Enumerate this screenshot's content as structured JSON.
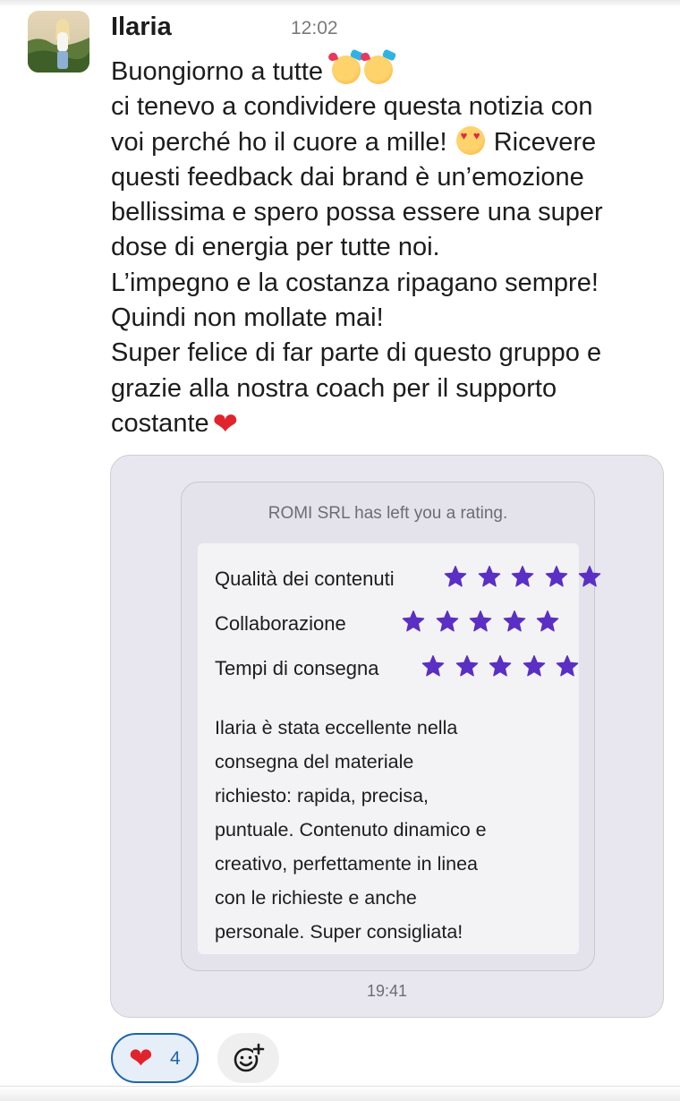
{
  "message": {
    "author": "Ilaria",
    "time": "12:02",
    "lines": [
      "Buongiorno a tutte",
      "ci tenevo a condividere questa notizia con",
      "voi perché ho il cuore a mille!",
      "Ricevere",
      "questi feedback dai brand è un’emozione",
      "bellissima e spero possa essere una super",
      "dose di energia per tutte noi.",
      "L’impegno e la costanza ripagano sempre!",
      "Quindi non mollate mai!",
      "Super felice di far parte di questo gruppo e",
      "grazie alla nostra coach per il supporto",
      "costante"
    ],
    "emoji": {
      "greeting": "smiling-face-with-hearts-icon",
      "eyes": "heart-eyes-icon",
      "heart": "red-heart-icon",
      "heart_glyph": "❤"
    }
  },
  "attachment": {
    "header": "ROMI SRL has left you a rating.",
    "ratings": [
      {
        "label": "Qualità dei contenuti",
        "stars": 5
      },
      {
        "label": "Collaborazione",
        "stars": 5
      },
      {
        "label": "Tempi di consegna",
        "stars": 5
      }
    ],
    "review_lines": [
      "Ilaria è stata eccellente nella",
      "consegna del materiale",
      "richiesto: rapida, precisa,",
      "puntuale. Contenuto dinamico e",
      "creativo, perfettamente in linea",
      "con le richieste e anche",
      "personale. Super consigliata!"
    ],
    "time": "19:41",
    "star_color": "#5a2fc4"
  },
  "reactions": {
    "heart": {
      "emoji": "❤",
      "count": "4",
      "icon": "red-heart-icon"
    },
    "add_icon": "add-reaction-icon",
    "accent": "#1d64b0"
  }
}
